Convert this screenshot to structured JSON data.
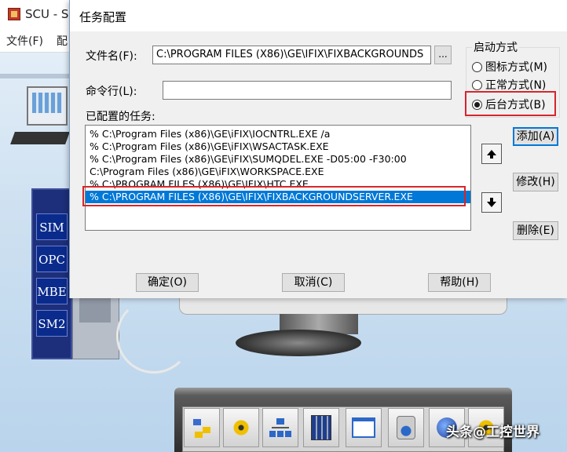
{
  "background": {
    "app_title": "SCU - S",
    "menu": [
      "文件(F)",
      "配"
    ],
    "rack_labels": [
      "SIM",
      "OPC",
      "MBE",
      "SM2"
    ],
    "watermark": "头条@工控世界"
  },
  "dialog": {
    "title": "任务配置",
    "filename_label": "文件名(F):",
    "filename_value": "C:\\PROGRAM FILES (X86)\\GE\\IFIX\\FIXBACKGROUNDS",
    "browse_label": "...",
    "cmdline_label": "命令行(L):",
    "cmdline_value": "",
    "tasks_label": "已配置的任务:",
    "tasks": [
      "% C:\\Program Files (x86)\\GE\\iFIX\\IOCNTRL.EXE  /a",
      "% C:\\Program Files (x86)\\GE\\iFIX\\WSACTASK.EXE",
      "% C:\\Program Files (x86)\\GE\\iFIX\\SUMQDEL.EXE  -D05:00 -F30:00",
      "  C:\\Program Files (x86)\\GE\\iFIX\\WORKSPACE.EXE",
      "% C:\\PROGRAM FILES (X86)\\GE\\IFIX\\HTC.EXE",
      "% C:\\PROGRAM FILES (X86)\\GE\\IFIX\\FIXBACKGROUNDSERVER.EXE"
    ],
    "selected_task_index": 5,
    "startup_group_label": "启动方式",
    "startup_options": [
      "图标方式(M)",
      "正常方式(N)",
      "后台方式(B)"
    ],
    "startup_selected_index": 2,
    "buttons": {
      "add": "添加(A)",
      "modify": "修改(H)",
      "delete": "删除(E)",
      "ok": "确定(O)",
      "cancel": "取消(C)",
      "help": "帮助(H)"
    }
  }
}
